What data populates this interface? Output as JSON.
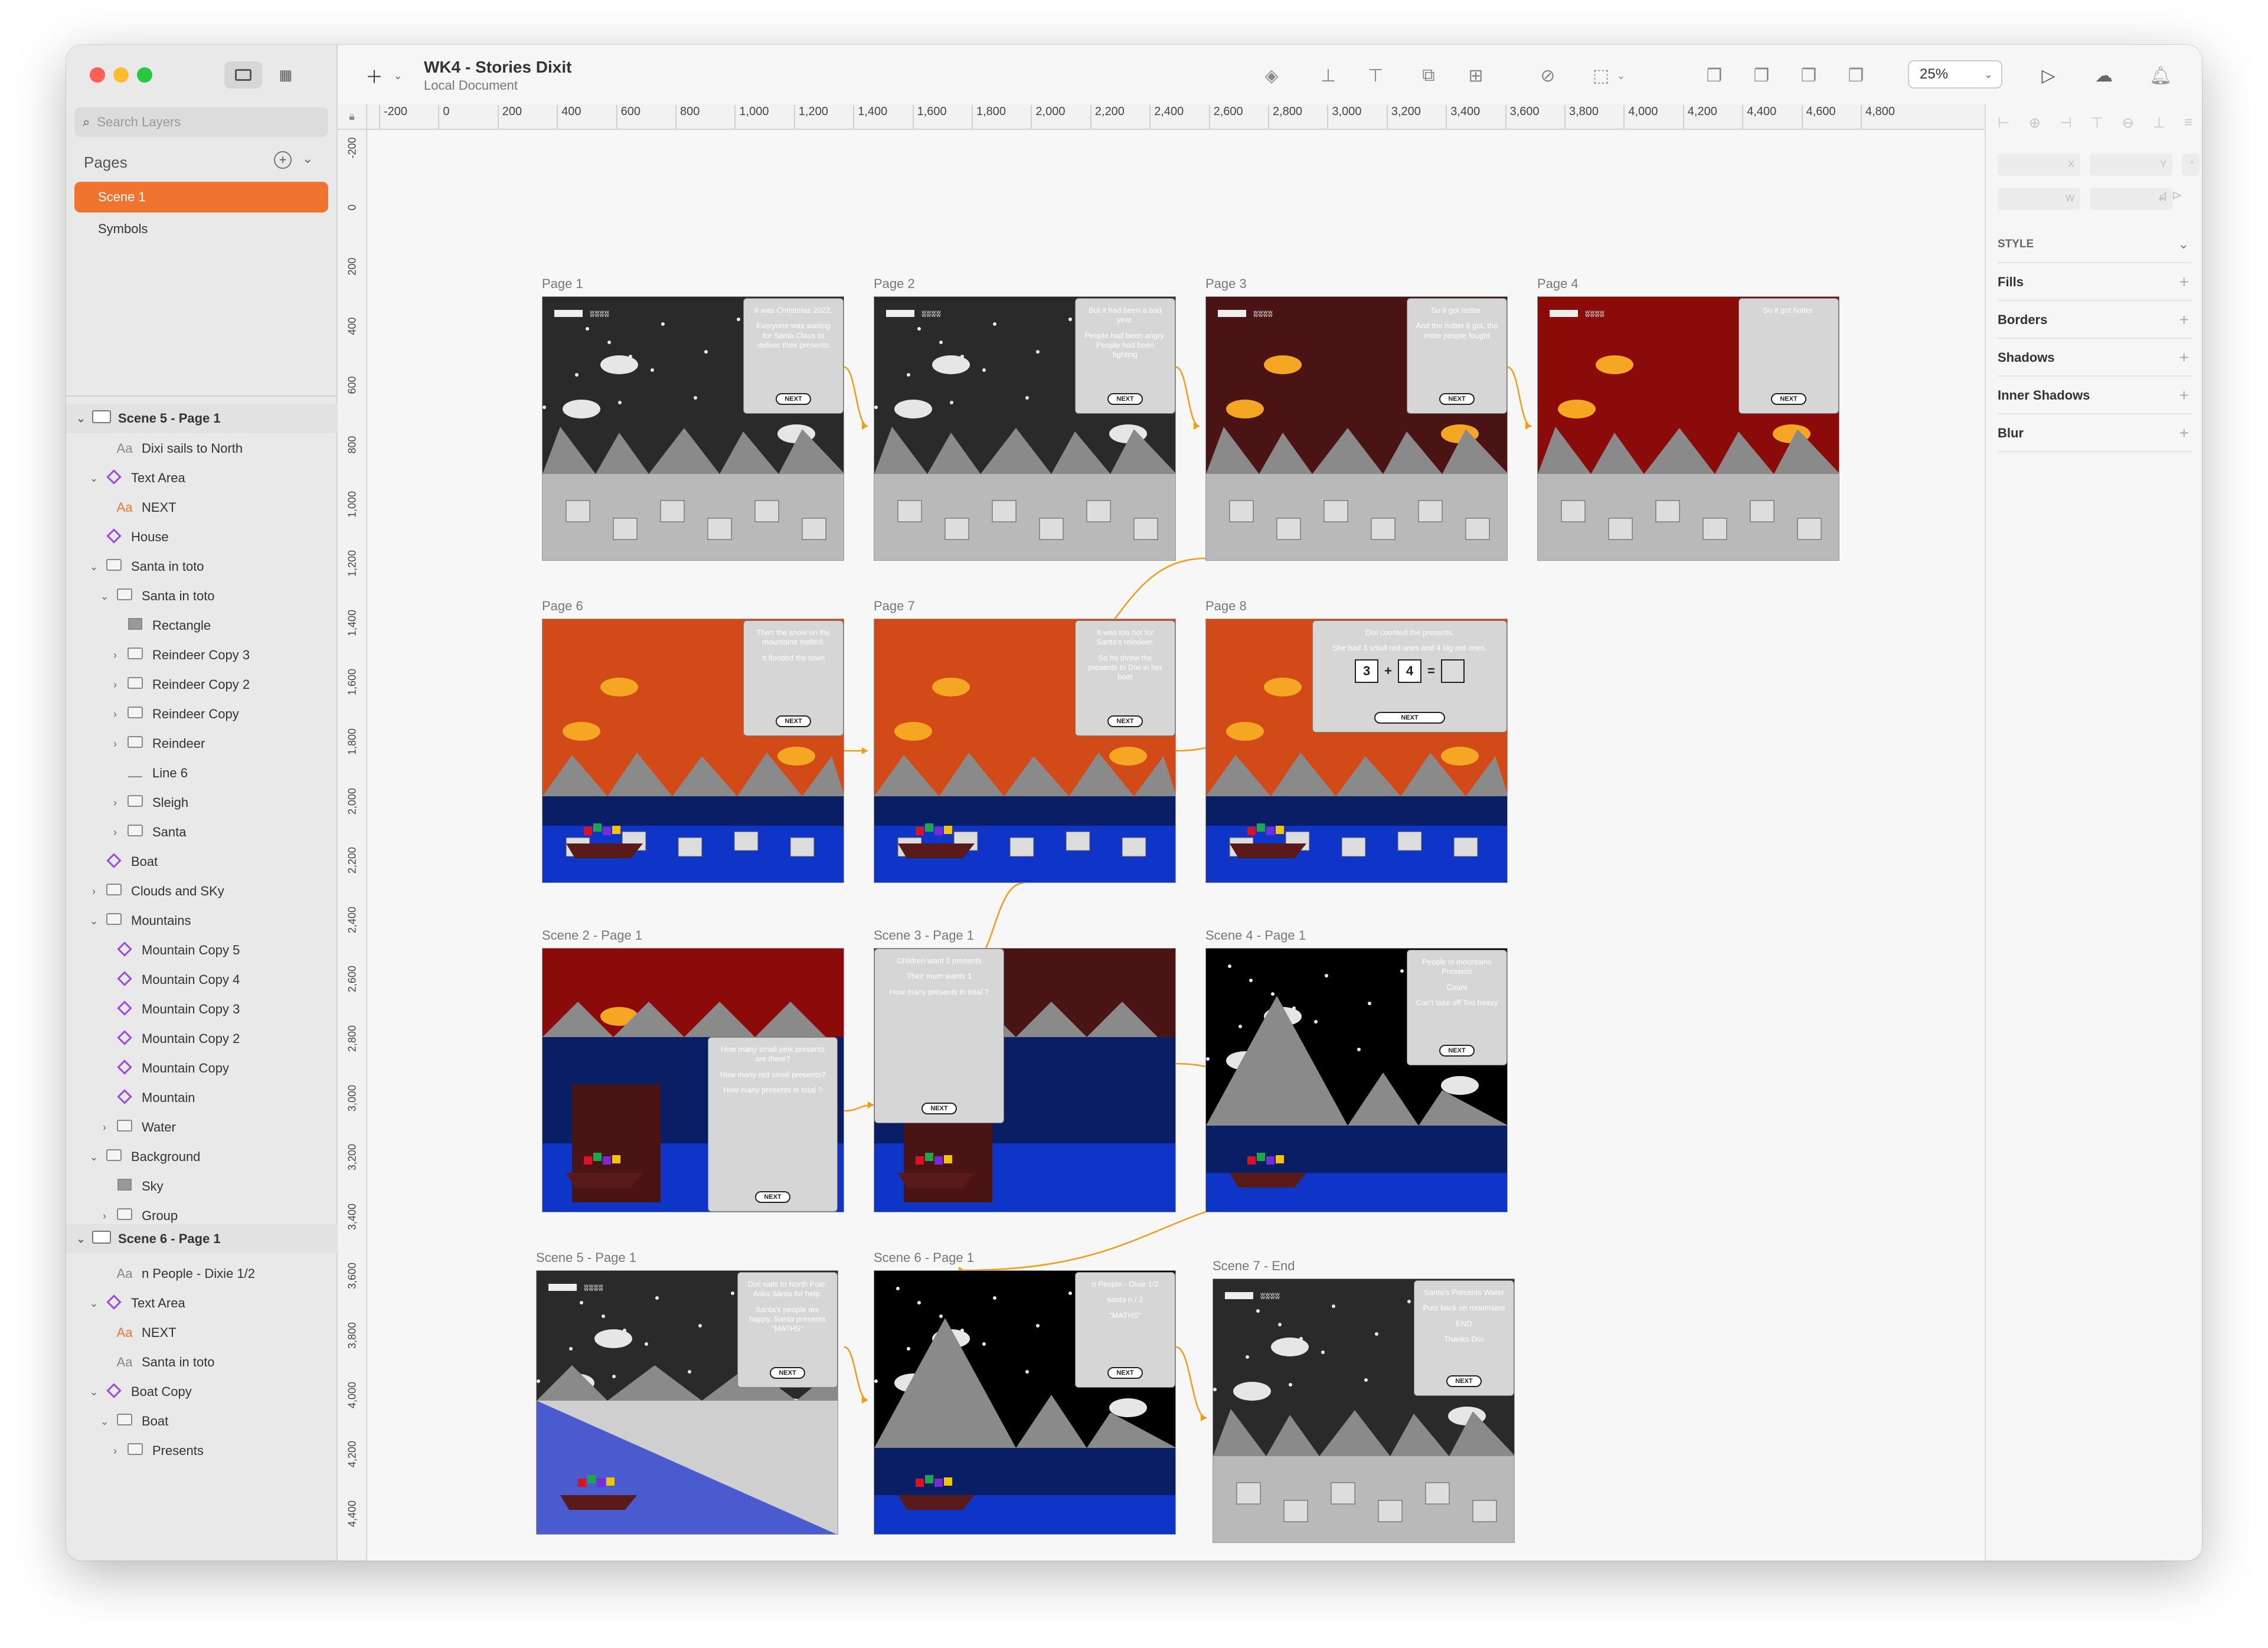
{
  "window": {
    "doc_title": "WK4 - Stories Dixit",
    "doc_subtitle": "Local Document"
  },
  "sidebar": {
    "search_placeholder": "Search Layers",
    "pages_header": "Pages",
    "pages": [
      "Scene 1",
      "Symbols"
    ],
    "groups": [
      {
        "title": "Scene 5 - Page 1"
      },
      {
        "title": "Scene 6 - Page 1"
      }
    ],
    "layers_a": [
      {
        "label": "Dixi sails to North",
        "icon": "text-icon"
      },
      {
        "label": "Text Area",
        "icon": "symbol-icon"
      },
      {
        "label": "NEXT",
        "icon": "text-icon"
      },
      {
        "label": "House",
        "icon": "symbol-icon"
      },
      {
        "label": "Santa in toto",
        "icon": "folder-icon"
      },
      {
        "label": "Santa in toto",
        "icon": "folder-icon"
      },
      {
        "label": "Rectangle",
        "icon": "rectangle-icon"
      },
      {
        "label": "Reindeer Copy 3",
        "icon": "folder-icon"
      },
      {
        "label": "Reindeer Copy 2",
        "icon": "folder-icon"
      },
      {
        "label": "Reindeer Copy",
        "icon": "folder-icon"
      },
      {
        "label": "Reindeer",
        "icon": "folder-icon"
      },
      {
        "label": "Line 6",
        "icon": "line-icon"
      },
      {
        "label": "Sleigh",
        "icon": "folder-icon"
      },
      {
        "label": "Santa",
        "icon": "folder-icon"
      },
      {
        "label": "Boat",
        "icon": "symbol-icon"
      },
      {
        "label": "Clouds and SKy",
        "icon": "folder-icon"
      },
      {
        "label": "Mountains",
        "icon": "folder-icon"
      },
      {
        "label": "Mountain Copy 5",
        "icon": "symbol-icon"
      },
      {
        "label": "Mountain Copy 4",
        "icon": "symbol-icon"
      },
      {
        "label": "Mountain Copy 3",
        "icon": "symbol-icon"
      },
      {
        "label": "Mountain Copy 2",
        "icon": "symbol-icon"
      },
      {
        "label": "Mountain Copy",
        "icon": "symbol-icon"
      },
      {
        "label": "Mountain",
        "icon": "symbol-icon"
      },
      {
        "label": "Water",
        "icon": "folder-icon"
      },
      {
        "label": "Background",
        "icon": "folder-icon"
      },
      {
        "label": "Sky",
        "icon": "rectangle-icon"
      },
      {
        "label": "Group",
        "icon": "folder-icon"
      }
    ],
    "layers_b": [
      {
        "label": "n People - Dixie 1/2",
        "icon": "text-icon"
      },
      {
        "label": "Text Area",
        "icon": "symbol-icon"
      },
      {
        "label": "NEXT",
        "icon": "text-icon"
      },
      {
        "label": "Santa in toto",
        "icon": "text-icon"
      },
      {
        "label": "Boat Copy",
        "icon": "symbol-icon"
      },
      {
        "label": "Boat",
        "icon": "folder-icon"
      },
      {
        "label": "Presents",
        "icon": "folder-icon"
      }
    ]
  },
  "toolbar": {
    "zoom": "25%"
  },
  "ruler": {
    "h_ticks": [
      "-200",
      "0",
      "200",
      "400",
      "600",
      "800",
      "1,000",
      "1,200",
      "1,400",
      "1,600",
      "1,800",
      "2,000",
      "2,200",
      "2,400",
      "2,600",
      "2,800",
      "3,000",
      "3,200",
      "3,400",
      "3,600",
      "3,800",
      "4,000",
      "4,200",
      "4,400",
      "4,600",
      "4,800"
    ],
    "v_ticks": [
      "-200",
      "0",
      "200",
      "400",
      "600",
      "800",
      "1,000",
      "1,200",
      "1,400",
      "1,600",
      "1,800",
      "2,000",
      "2,200",
      "2,400",
      "2,600",
      "2,800",
      "3,000",
      "3,200",
      "3,400",
      "3,600",
      "3,800",
      "4,000",
      "4,200",
      "4,400"
    ]
  },
  "inspector": {
    "style_label": "STYLE",
    "sections": [
      "Fills",
      "Borders",
      "Shadows",
      "Inner Shadows",
      "Blur"
    ],
    "fields": [
      "X",
      "Y",
      "°",
      "W",
      "H"
    ]
  },
  "artboards": [
    {
      "label": "Page 1",
      "sky": "#2a2a2a",
      "text": [
        "It was Christmas 2022.",
        "Everyone was waiting for Santa Claus to deliver their presents"
      ],
      "next": "NEXT"
    },
    {
      "label": "Page 2",
      "sky": "#2a2a2a",
      "text": [
        "But it had been a bad year.",
        "People had been angry. People had been fighting"
      ],
      "next": "NEXT"
    },
    {
      "label": "Page 3",
      "sky": "#4a1414",
      "text": [
        "So it got hotter.",
        "And the hotter it got, the more people fought"
      ],
      "next": "NEXT"
    },
    {
      "label": "Page 4",
      "sky": "#8b0b0b",
      "text": [
        "So it got hotter."
      ],
      "next": "NEXT"
    },
    {
      "label": "Page 6",
      "sky": "#d14a17",
      "text": [
        "Then the snow on the mountains melted.",
        "It flooded the town"
      ],
      "next": "NEXT"
    },
    {
      "label": "Page 7",
      "sky": "#d14a17",
      "text": [
        "It was too hot for Santa's reindeer.",
        "So he threw the presents to Dixi in her boat"
      ],
      "next": "NEXT"
    },
    {
      "label": "Page 8",
      "sky": "#d14a17",
      "text": [
        "Dixi counted the presents.",
        "She had 3 small red ones and 4 big red ones."
      ],
      "next": "NEXT",
      "eq": [
        "3",
        "+",
        "4",
        "="
      ]
    },
    {
      "label": "Scene 2 - Page 1",
      "sky": "#8b0b0b",
      "text": [
        "How many small pink presents are there?",
        "How many red small presents?",
        "How many presents in total ?"
      ],
      "next": "NEXT"
    },
    {
      "label": "Scene 3 - Page 1",
      "sky": "#4a1414",
      "text": [
        "Children want 2 presents",
        "Their mum wants 1",
        "How many presents in total ?"
      ],
      "next": "NEXT"
    },
    {
      "label": "Scene 4 - Page 1",
      "sky": "#000000",
      "text": [
        "People in mountains Presents",
        "Count",
        "Can't take off Too heavy"
      ],
      "next": "NEXT"
    },
    {
      "label": "Scene 5 - Page 1",
      "sky": "#2a2a2a",
      "text": [
        "Dixi sails to North Pole. Asks Santa for help.",
        "Santa's people are happy. Santa presents \"MATHS\""
      ],
      "next": "NEXT"
    },
    {
      "label": "Scene 6 - Page 1",
      "sky": "#000000",
      "text": [
        "n People - Dixie 1/2",
        "santa n / 2",
        "\"MATHS\""
      ],
      "next": "NEXT"
    },
    {
      "label": "Scene 7 - End",
      "sky": "#2a2a2a",
      "text": [
        "Santa's Presents Water",
        "Puts back on mountains",
        "END",
        "Thanks Dixi"
      ],
      "next": "NEXT"
    }
  ]
}
